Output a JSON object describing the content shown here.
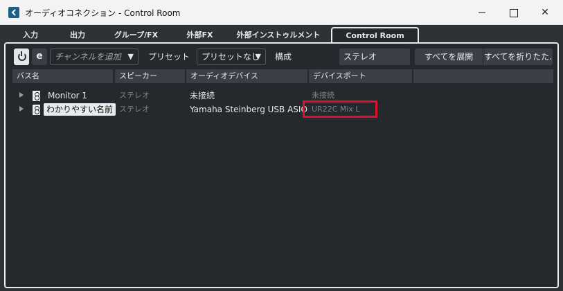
{
  "window": {
    "title": "オーディオコネクション - Control Room"
  },
  "tabs": [
    {
      "label": "入力"
    },
    {
      "label": "出力"
    },
    {
      "label": "グループ/FX"
    },
    {
      "label": "外部FX"
    },
    {
      "label": "外部インストゥルメント"
    },
    {
      "label": "Control Room",
      "active": true
    }
  ],
  "toolbar": {
    "add_channel": "チャンネルを追加",
    "preset_label": "プリセット",
    "preset_value": "プリセットなし",
    "config_label": "構成",
    "config_value": "ステレオ",
    "expand_all": "すべてを展開",
    "collapse_all": "すべてを折りたた."
  },
  "columns": [
    "バス名",
    "スピーカー",
    "オーディオデバイス",
    "デバイスポート",
    ""
  ],
  "rows": [
    {
      "name": "Monitor 1",
      "speaker": "ステレオ",
      "device": "未接続",
      "port": "未接続",
      "editing": false
    },
    {
      "name": "わかりやすい名前",
      "speaker": "ステレオ",
      "device": "Yamaha Steinberg USB ASIO",
      "port": "UR22C Mix L",
      "editing": true
    }
  ],
  "colors": {
    "highlight": "#e0102a",
    "accent": "#1f5f86"
  },
  "icons": {
    "app": "cubase-app-icon",
    "power": "power-icon",
    "edit": "e-icon",
    "speaker": "speaker-icon"
  }
}
